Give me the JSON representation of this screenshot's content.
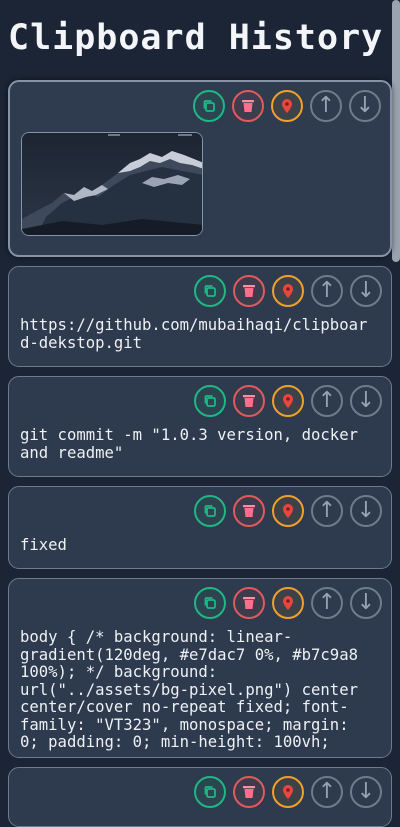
{
  "page": {
    "title": "Clipboard History"
  },
  "items": [
    {
      "type": "image",
      "content": ""
    },
    {
      "type": "text",
      "content": "https://github.com/mubaihaqi/clipboard-dekstop.git"
    },
    {
      "type": "text",
      "content": "git commit -m \"1.0.3 version, docker and readme\""
    },
    {
      "type": "text",
      "content": "fixed"
    },
    {
      "type": "text",
      "content": "body { /* background: linear-gradient(120deg, #e7dac7 0%, #b7c9a8 100%); */ background: url(\"../assets/bg-pixel.png\") center center/cover no-repeat fixed; font-family: \"VT323\", monospace; margin: 0; padding: 0; min-height: 100vh;"
    },
    {
      "type": "text",
      "content": ""
    }
  ],
  "icons": {
    "copy": "copy-icon",
    "delete": "trash-icon",
    "pin": "pin-icon",
    "move_up": "arrow-up-icon",
    "move_down": "arrow-down-icon"
  },
  "button_glyphs": {
    "move_up": "↑",
    "move_down": "↓"
  },
  "colors": {
    "background": "#1b2536",
    "card": "#2e3a4d",
    "copy": "#1fb885",
    "delete": "#e25a5a",
    "pin": "#f0a12a",
    "neutral": "#707c8d"
  }
}
